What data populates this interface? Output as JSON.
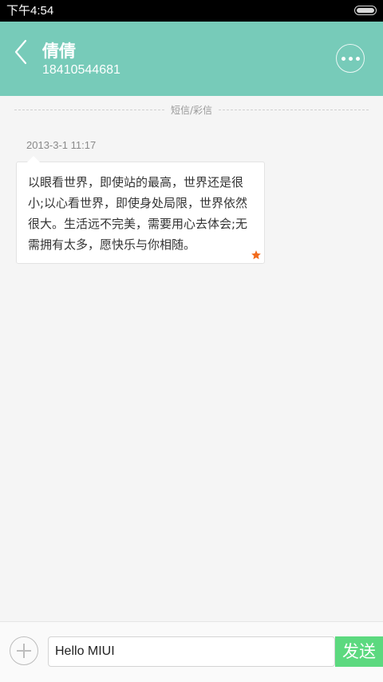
{
  "status_bar": {
    "time": "下午4:54"
  },
  "header": {
    "back_icon": "chevron-left-icon",
    "contact_name": "倩倩",
    "contact_number": "18410544681",
    "more_icon": "more-dots-icon"
  },
  "thread": {
    "divider_label": "短信/彩信",
    "messages": [
      {
        "timestamp": "2013-3-1 11:17",
        "text": "以眼看世界，即使站的最高，世界还是很小;以心看世界，即使身处局限，世界依然很大。生活远不完美，需要用心去体会;无需拥有太多，愿快乐与你相随。",
        "starred": true
      }
    ]
  },
  "composer": {
    "attach_icon": "plus-circle-icon",
    "input_value": "Hello MIUI",
    "send_label": "发送"
  },
  "colors": {
    "header_bg": "#77cbb9",
    "send_button_bg": "#5cd97f",
    "star": "#f26b1d"
  }
}
